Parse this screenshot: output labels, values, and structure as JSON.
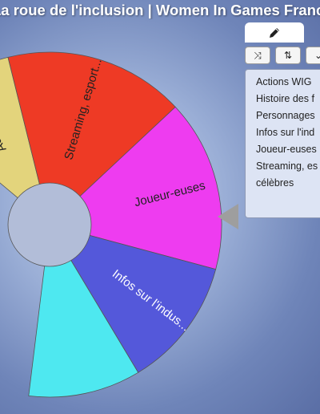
{
  "title": "La roue de l'inclusion | Women In Games France",
  "wheel": {
    "segments": [
      {
        "label": "Actions WIG",
        "color": "#e3d47c",
        "text_color": "#222222"
      },
      {
        "label": "Streaming, esport...",
        "color": "#ee3a25",
        "text_color": "#222222"
      },
      {
        "label": "Joueur-euses",
        "color": "#ee3cf0",
        "text_color": "#222222"
      },
      {
        "label": "Infos sur l'indus...",
        "color": "#5458da",
        "text_color": "#ffffff"
      },
      {
        "label": "",
        "color": "#4ee8f0",
        "text_color": "#222222"
      }
    ],
    "hub_color": "#b2bdd8"
  },
  "panel": {
    "tab_icon": "pencil-icon",
    "toolbar": [
      {
        "icon": "shuffle-icon",
        "glyph": "⤨"
      },
      {
        "icon": "sort-icon",
        "glyph": "⇅"
      },
      {
        "icon": "more-icon",
        "glyph": "⌄"
      }
    ],
    "entries": [
      "Actions WIG",
      "Histoire des f",
      "Personnages",
      "Infos sur l'ind",
      "Joueur-euses",
      "Streaming, es",
      "célèbres"
    ]
  },
  "pointer_color": "#9e9e9e"
}
